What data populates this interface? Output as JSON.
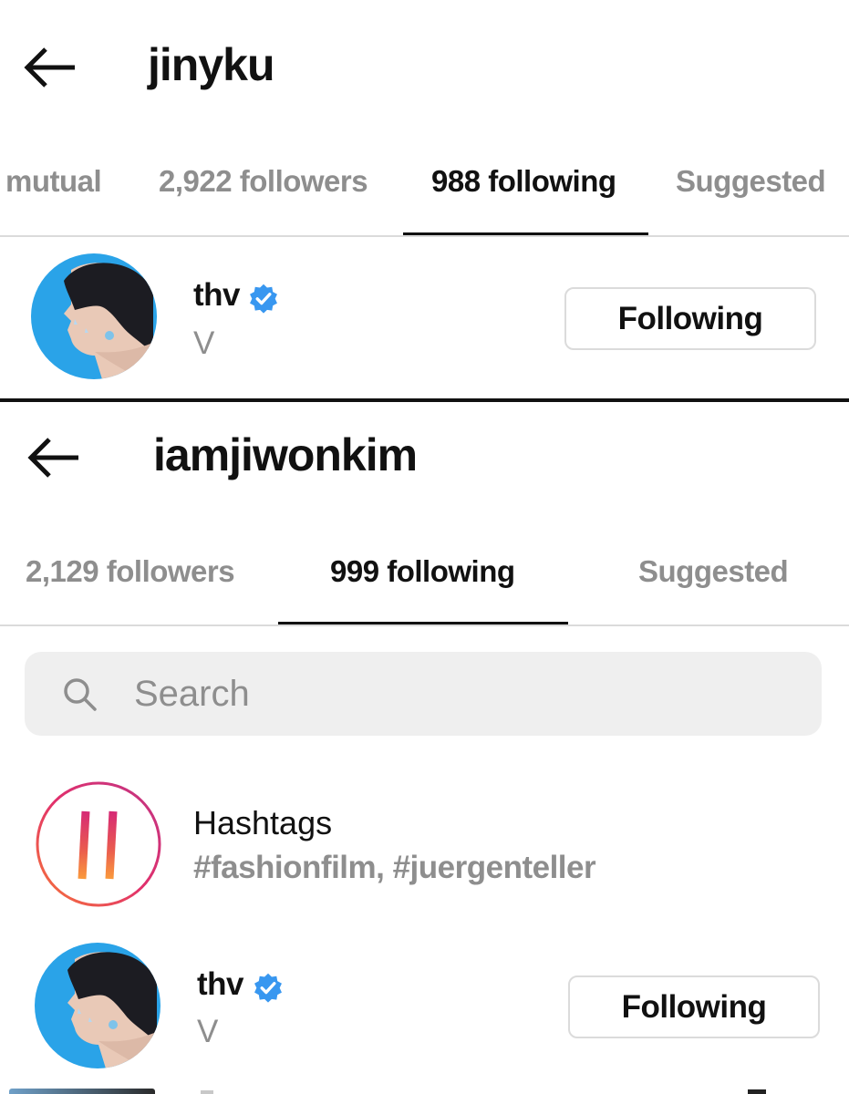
{
  "top_panel": {
    "username": "jinyku",
    "tabs": [
      {
        "label": "mutual",
        "active": false
      },
      {
        "label": "2,922 followers",
        "active": false
      },
      {
        "label": "988 following",
        "active": true
      },
      {
        "label": "Suggested",
        "active": false
      }
    ],
    "account": {
      "username": "thv",
      "verified": true,
      "full_name": "V",
      "button_label": "Following"
    }
  },
  "bottom_panel": {
    "username": "iamjiwonkim",
    "tabs": [
      {
        "label": "2,129 followers",
        "active": false
      },
      {
        "label": "999 following",
        "active": true
      },
      {
        "label": "Suggested",
        "active": false
      }
    ],
    "search": {
      "placeholder": "Search",
      "value": ""
    },
    "hashtags": {
      "title": "Hashtags",
      "subtitle": "#fashionfilm, #juergenteller"
    },
    "account": {
      "username": "thv",
      "verified": true,
      "full_name": "V",
      "button_label": "Following"
    }
  },
  "colors": {
    "text_primary": "#111111",
    "text_secondary": "#8e8e8e",
    "verified_blue": "#3897f0",
    "border": "#dbdbdb",
    "search_bg": "#efefef",
    "avatar_bg": "#2aa3e8"
  },
  "icons": [
    "back-arrow-icon",
    "verified-badge-icon",
    "search-icon",
    "hashtag-icon"
  ]
}
